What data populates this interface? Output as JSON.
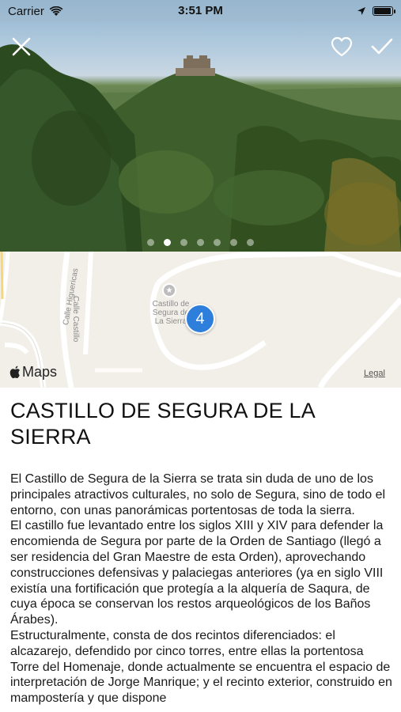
{
  "status_bar": {
    "carrier": "Carrier",
    "time": "3:51 PM",
    "battery_level": 0.95
  },
  "gallery": {
    "slide_count": 7,
    "active_index": 1
  },
  "map": {
    "streets": [
      "Calle Higuericas",
      "Calle Castillo"
    ],
    "poi_label": [
      "Castillo de",
      "Segura de",
      "La Sierra"
    ],
    "cluster_count": "4",
    "brand": "Maps",
    "legal": "Legal"
  },
  "content": {
    "title": "CASTILLO DE SEGURA DE LA SIERRA",
    "paragraphs": [
      "El Castillo de Segura de la Sierra se trata sin duda de uno de los principales atractivos culturales, no solo de Segura, sino de todo el entorno, con unas panorámicas portentosas de toda la sierra.",
      "El castillo fue levantado entre los siglos XIII y XIV para defender la encomienda de Segura por parte de la Orden de Santiago (llegó a ser residencia del Gran Maestre de esta Orden), aprovechando construcciones defensivas y palaciegas anteriores (ya en siglo VIII existía una fortificación que protegía a la alquería de Saqura, de cuya época se conservan los restos arqueológicos de los Baños Árabes).",
      "Estructuralmente, consta de dos recintos diferenciados: el alcazarejo, defendido por cinco torres, entre ellas la portentosa Torre del Homenaje, donde actualmente se encuentra el espacio de interpretación de Jorge Manrique; y el recinto exterior, construido en mampostería y que dispone"
    ]
  }
}
